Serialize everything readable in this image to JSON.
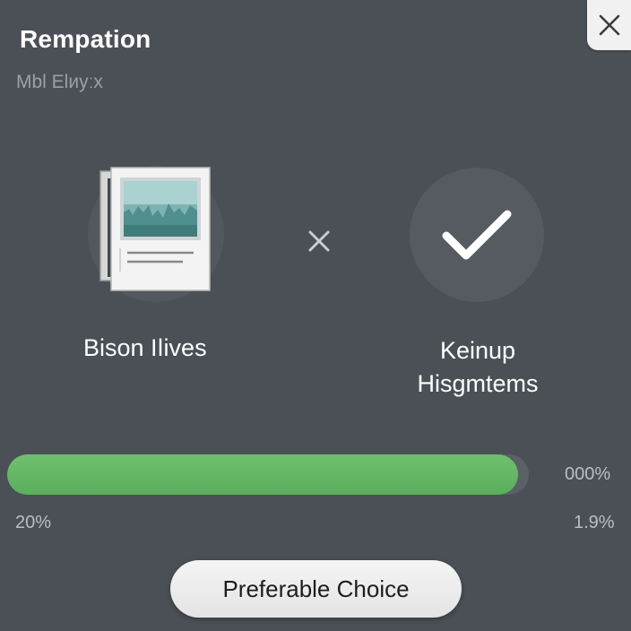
{
  "dialog": {
    "title": "Rempation",
    "subtitle": "Mbl Elиyːx",
    "close_icon": "close-icon"
  },
  "options": {
    "left": {
      "label": "Bison Iǀives",
      "icon": "image-document-icon"
    },
    "separator_icon": "x-icon",
    "right": {
      "label_line1": "Keinup",
      "label_line2": "Hisgmtems",
      "icon": "checkmark-icon"
    }
  },
  "progress": {
    "fill_fraction": 0.98,
    "right_top_text": "000%",
    "left_text": "20%",
    "right_bottom_text": "1.9%",
    "color": "#62b562"
  },
  "action": {
    "button_label": "Preferable Choice"
  },
  "colors": {
    "background": "#4b5056",
    "accent_green": "#62b562",
    "button_bg": "#efefef"
  }
}
